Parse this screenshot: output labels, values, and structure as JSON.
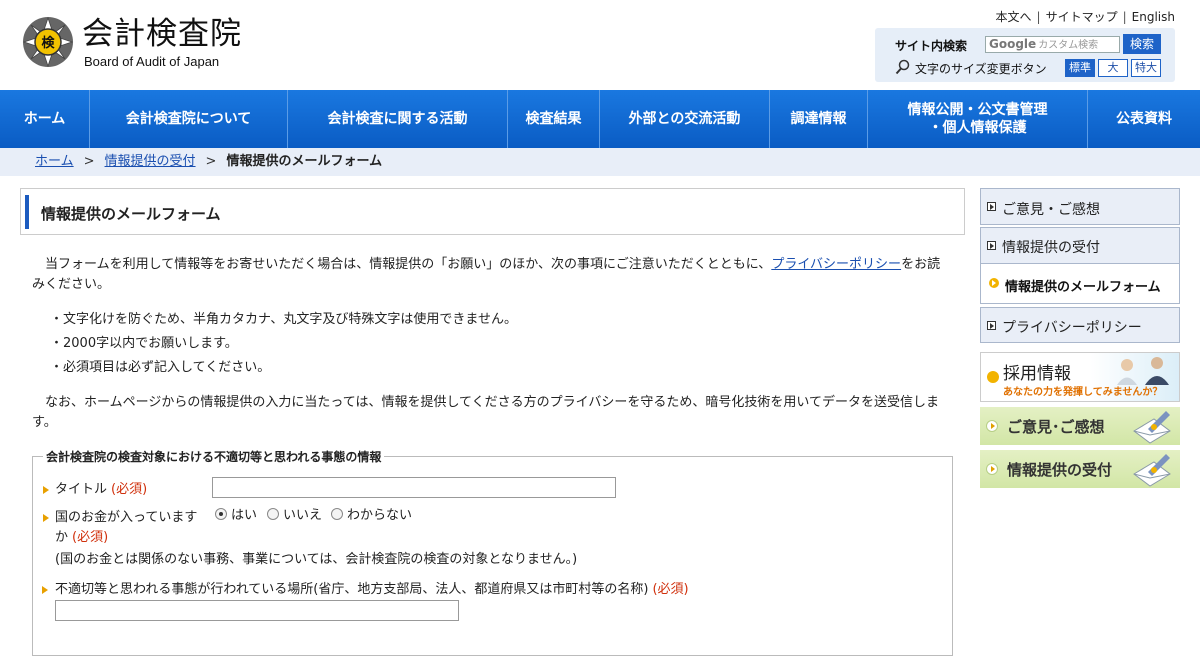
{
  "header": {
    "logo_jp": "会計検査院",
    "logo_en": "Board of Audit of Japan",
    "seal_char": "検",
    "util_links": [
      "本文へ",
      "サイトマップ",
      "English"
    ],
    "search_label": "サイト内検索",
    "search_placeholder_brand": "Google",
    "search_placeholder": "カスタム検索",
    "search_button": "検索",
    "font_size_label": "文字のサイズ変更ボタン",
    "font_sizes": [
      "標準",
      "大",
      "特大"
    ]
  },
  "nav": [
    "ホーム",
    "会計検査院について",
    "会計検査に関する活動",
    "検査結果",
    "外部との交流活動",
    "調達情報",
    "情報公開・公文書管理\n・個人情報保護",
    "公表資料"
  ],
  "breadcrumb": {
    "items": [
      "ホーム",
      "情報提供の受付"
    ],
    "current": "情報提供のメールフォーム"
  },
  "main": {
    "title": "情報提供のメールフォーム",
    "intro_before": "当フォームを利用して情報等をお寄せいただく場合は、情報提供の「お願い」のほか、次の事項にご注意いただくとともに、",
    "intro_link": "プライバシーポリシー",
    "intro_after": "をお読みください。",
    "notes": [
      "・文字化けを防ぐため、半角カタカナ、丸文字及び特殊文字は使用できません。",
      "・2000字以内でお願いします。",
      "・必須項目は必ず記入してください。"
    ],
    "encrypt": "なお、ホームページからの情報提供の入力に当たっては、情報を提供してくださる方のプライバシーを守るため、暗号化技術を用いてデータを送受信します。",
    "form": {
      "legend": "会計検査院の検査対象における不適切等と思われる事態の情報",
      "required_mark": "(必須)",
      "title_label": "タイトル",
      "money_label": "国のお金が入っていますか",
      "money_options": [
        "はい",
        "いいえ",
        "わからない"
      ],
      "money_selected": "はい",
      "money_note": "(国のお金とは関係のない事務、事業については、会計検査院の検査の対象となりません。)",
      "place_label": "不適切等と思われる事態が行われている場所(省庁、地方支部局、法人、都道府県又は市町村等の名称)"
    }
  },
  "sidebar": {
    "links": [
      "ご意見・ご感想",
      "情報提供の受付"
    ],
    "current": "情報提供のメールフォーム",
    "privacy": "プライバシーポリシー",
    "recruit_title": "採用情報",
    "recruit_sub": "あなたの力を発揮してみませんか？",
    "banner_opinion": "ご意見･ご感想",
    "banner_info": "情報提供の受付"
  },
  "colors": {
    "nav_blue": "#0a5cc4",
    "required_red": "#d0300c",
    "accent_yellow": "#f2b300"
  }
}
